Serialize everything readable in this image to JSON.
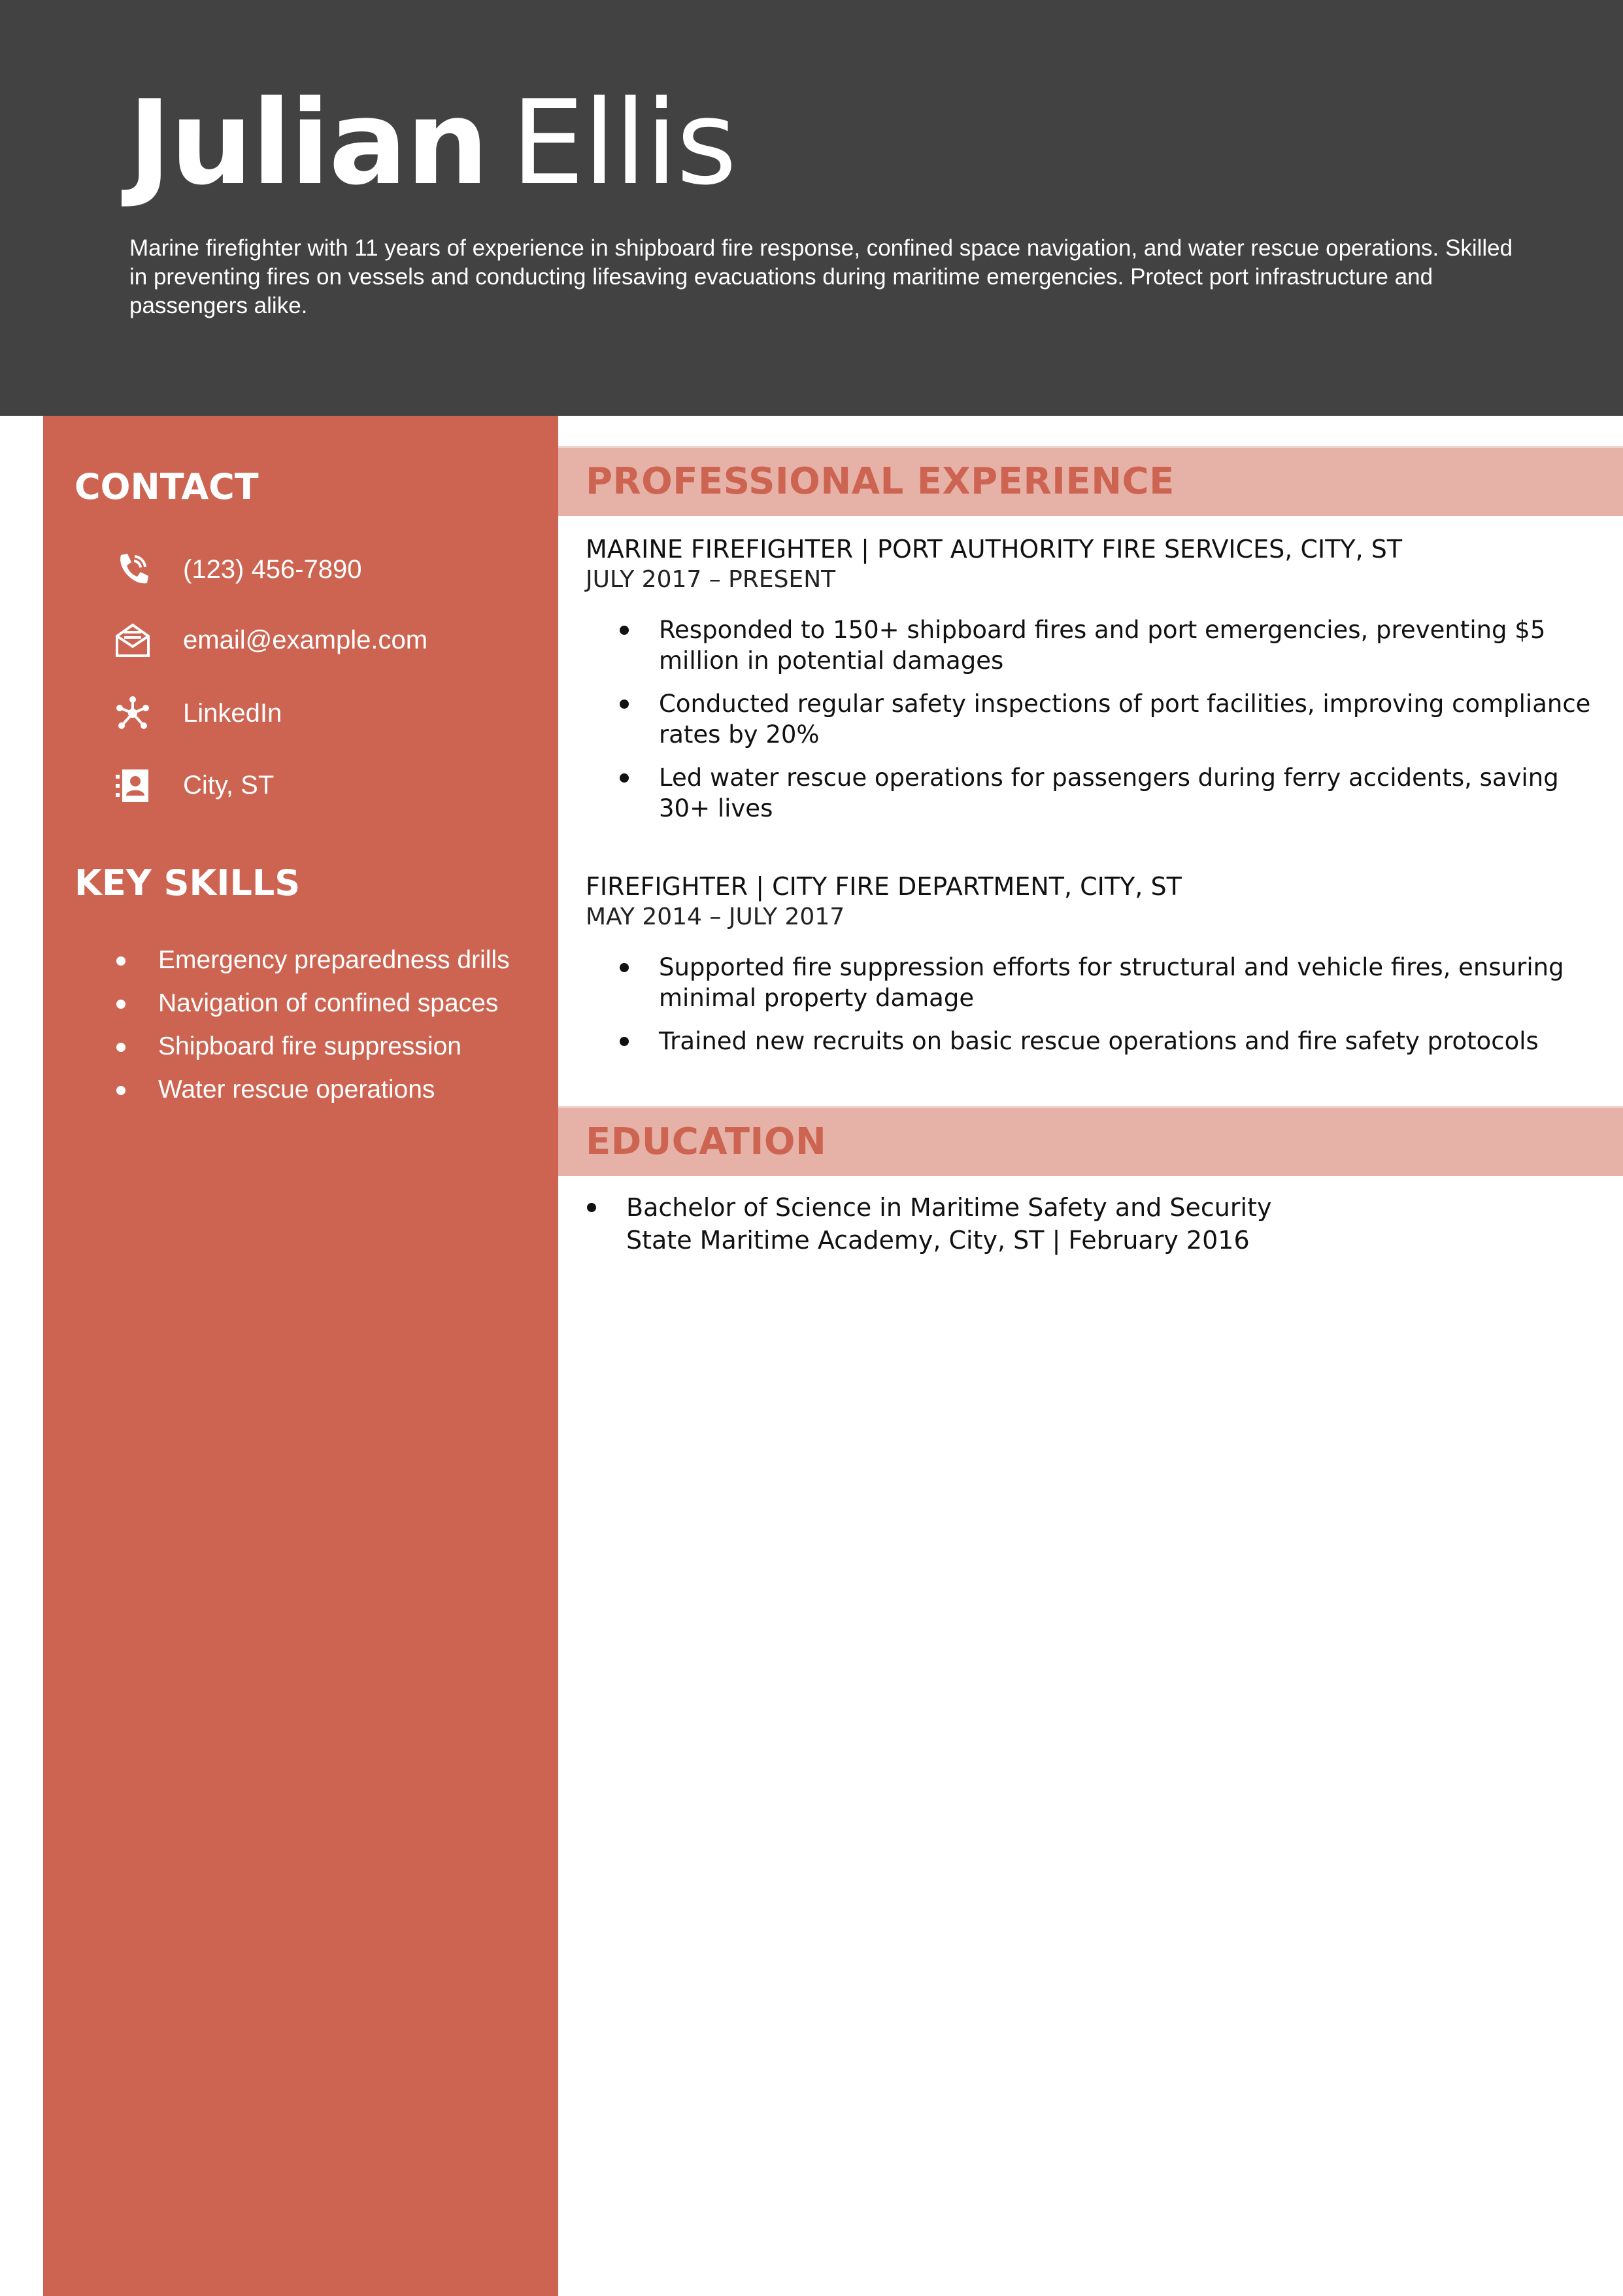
{
  "header": {
    "first_name": "Julian",
    "last_name": "Ellis",
    "summary": "Marine firefighter with 11 years of experience in shipboard fire response, confined space navigation, and water rescue operations. Skilled in preventing fires on vessels and conducting lifesaving evacuations during maritime emergencies. Protect port infrastructure and passengers alike."
  },
  "sidebar": {
    "contact_heading": "CONTACT",
    "contacts": [
      {
        "icon": "phone-icon",
        "text": "(123) 456-7890"
      },
      {
        "icon": "email-icon",
        "text": "email@example.com"
      },
      {
        "icon": "network-icon",
        "text": "LinkedIn"
      },
      {
        "icon": "address-card-icon",
        "text": "City, ST"
      }
    ],
    "skills_heading": "KEY SKILLS",
    "skills": [
      "Emergency preparedness drills",
      "Navigation of confined spaces",
      "Shipboard fire suppression",
      "Water rescue operations"
    ]
  },
  "experience": {
    "heading": "PROFESSIONAL EXPERIENCE",
    "jobs": [
      {
        "title": "MARINE FIREFIGHTER | PORT AUTHORITY FIRE SERVICES, CITY, ST",
        "dates": "JULY 2017 – PRESENT",
        "bullets": [
          "Responded to 150+ shipboard fires and port emergencies, preventing $5 million in potential damages",
          "Conducted regular safety inspections of port facilities, improving compliance rates by 20%",
          "Led water rescue operations for passengers during ferry accidents, saving 30+ lives"
        ]
      },
      {
        "title": "FIREFIGHTER |  CITY FIRE DEPARTMENT, CITY, ST",
        "dates": "MAY 2014 – JULY 2017",
        "bullets": [
          "Supported fire suppression efforts for structural and vehicle fires, ensuring minimal property damage",
          "Trained new recruits on basic rescue operations and fire safety protocols"
        ]
      }
    ]
  },
  "education": {
    "heading": "EDUCATION",
    "degree": "Bachelor of Science in Maritime Safety and Security",
    "school": "State Maritime Academy, City, ST | February 2016"
  },
  "colors": {
    "header_bg": "#424242",
    "sidebar_bg": "#cd6451",
    "section_band": "#e6b1a7",
    "accent": "#cd6451"
  }
}
